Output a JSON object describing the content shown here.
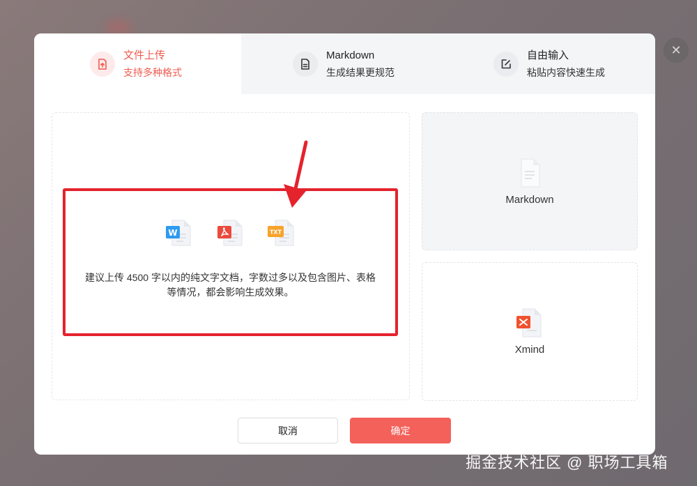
{
  "tabs": [
    {
      "title": "文件上传",
      "subtitle": "支持多种格式",
      "active": true
    },
    {
      "title": "Markdown",
      "subtitle": "生成结果更规范",
      "active": false
    },
    {
      "title": "自由输入",
      "subtitle": "粘贴内容快速生成",
      "active": false
    }
  ],
  "upload": {
    "file_types": [
      "word-doc-icon",
      "pdf-doc-icon",
      "txt-doc-icon"
    ],
    "txt_badge": "TXT",
    "hint_line1": "建议上传 4500 字以内的纯文字文档，字数过多以及包含图片、表格",
    "hint_line2": "等情况，都会影响生成效果。"
  },
  "cards": {
    "markdown_label": "Markdown",
    "xmind_label": "Xmind"
  },
  "buttons": {
    "cancel": "取消",
    "confirm": "确定"
  },
  "close_glyph": "✕",
  "watermark": "掘金技术社区 @ 职场工具箱",
  "colors": {
    "accent": "#ef5b4f",
    "confirm_bg": "#f4605a",
    "highlight": "#e4232d"
  }
}
